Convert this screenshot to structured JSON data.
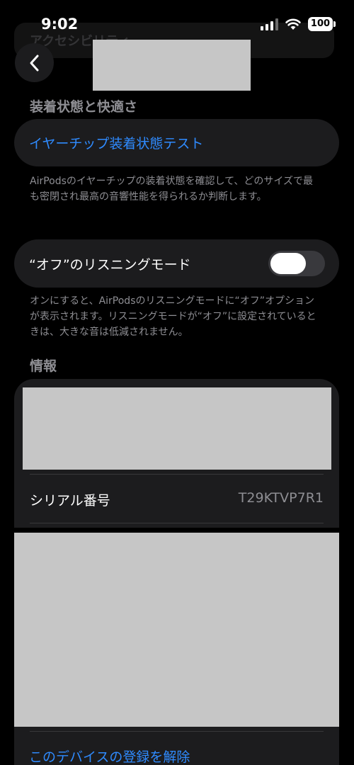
{
  "status_bar": {
    "time": "9:02",
    "battery": "100",
    "behind_title": "アクセシビリティ"
  },
  "nav": {
    "back_icon": "chevron-left-icon"
  },
  "fit_section": {
    "header": "装着状態と快適さ",
    "ear_tip_test_label": "イヤーチップ装着状態テスト",
    "footnote": "AirPodsのイヤーチップの装着状態を確認して、どのサイズで最も密閉され最高の音響性能を得られるか判断します。"
  },
  "listening_mode": {
    "label": "“オフ”のリスニングモード",
    "toggle_on": false,
    "footnote": "オンにすると、AirPodsのリスニングモードに“オフ”オプションが表示されます。リスニングモードが“オフ”に設定されているときは、大きな音は低減されません。"
  },
  "info_section": {
    "header": "情報",
    "serial_label": "シリアル番号",
    "serial_value": "T29KTVP7R1"
  },
  "unregister_label": "このデバイスの登録を解除",
  "colors": {
    "accent": "#2f8bff",
    "card": "#1c1c1e",
    "background": "#000000"
  }
}
